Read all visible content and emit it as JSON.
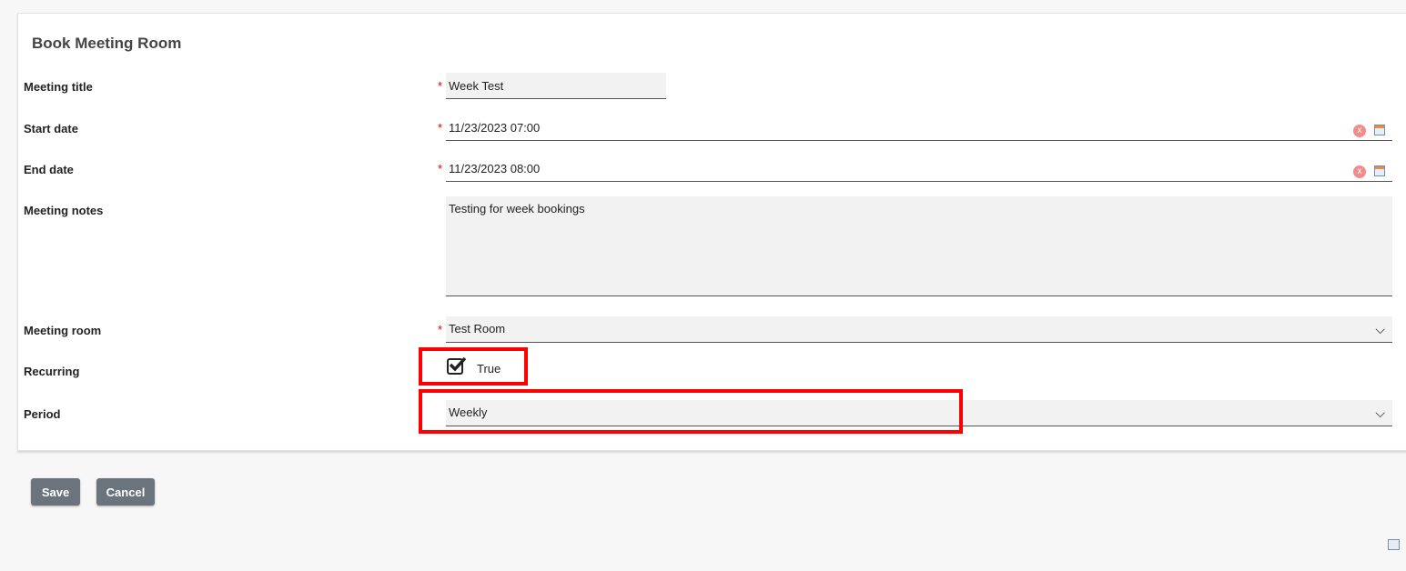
{
  "form": {
    "title": "Book Meeting Room",
    "required_mark": "*",
    "meeting_title": {
      "label": "Meeting title",
      "value": "Week Test"
    },
    "start_date": {
      "label": "Start date",
      "value": "11/23/2023 07:00"
    },
    "end_date": {
      "label": "End date",
      "value": "11/23/2023 08:00"
    },
    "notes": {
      "label": "Meeting notes",
      "value": "Testing for week bookings"
    },
    "room": {
      "label": "Meeting room",
      "value": "Test Room"
    },
    "recurring": {
      "label": "Recurring",
      "value": "True",
      "checked": true
    },
    "period": {
      "label": "Period",
      "value": "Weekly"
    },
    "clear_glyph": "x"
  },
  "actions": {
    "save": "Save",
    "cancel": "Cancel"
  },
  "colors": {
    "highlight": "#ff0000",
    "button": "#6b737c"
  }
}
